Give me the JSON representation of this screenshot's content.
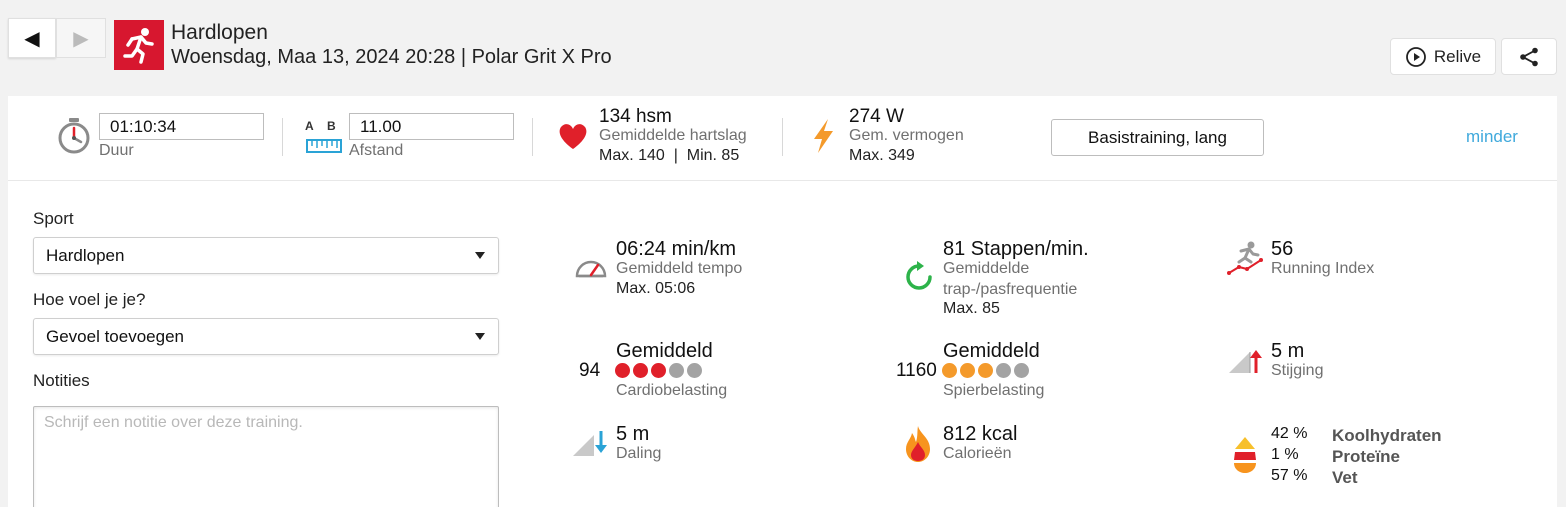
{
  "header": {
    "title": "Hardlopen",
    "subtitle": "Woensdag, Maa 13, 2024 20:28 | Polar Grit X Pro",
    "back_glyph": "◀",
    "forward_glyph": "▶",
    "relive_label": "Relive",
    "icons": {
      "sport": "running-icon",
      "relive": "play-circle-icon",
      "share": "share-icon"
    },
    "accent_color": "#d7172f"
  },
  "summary": {
    "duration": {
      "value": "01:10:34",
      "label": "Duur"
    },
    "distance": {
      "value": "11.00",
      "label": "Afstand",
      "a": "A",
      "b": "B"
    },
    "heart_rate": {
      "value": "134 hsm",
      "label": "Gemiddelde hartslag",
      "max": "Max. 140",
      "sep": "|",
      "min": "Min. 85"
    },
    "power": {
      "value": "274 W",
      "label": "Gem. vermogen",
      "max": "Max. 349"
    },
    "training_type": "Basistraining, lang",
    "less_link": "minder",
    "link_color": "#3fa9dc"
  },
  "form": {
    "sport_label": "Sport",
    "sport_value": "Hardlopen",
    "feeling_label": "Hoe voel je je?",
    "feeling_value": "Gevoel toevoegen",
    "notes_label": "Notities",
    "notes_placeholder": "Schrijf een notitie over deze training."
  },
  "metrics": {
    "pace": {
      "value": "06:24 min/km",
      "label": "Gemiddeld tempo",
      "max": "Max. 05:06"
    },
    "cadence": {
      "value": "81 Stappen/min.",
      "label1": "Gemiddelde",
      "label2": "trap-/pasfrequentie",
      "max": "Max. 85"
    },
    "running_index": {
      "value": "56",
      "label": "Running Index"
    },
    "cardio_load": {
      "number": "94",
      "value": "Gemiddeld",
      "label": "Cardiobelasting",
      "level": 3,
      "of": 5,
      "color": "#e0202a"
    },
    "muscle_load": {
      "number": "1160",
      "value": "Gemiddeld",
      "label": "Spierbelasting",
      "level": 3,
      "of": 5,
      "color": "#f49a2b"
    },
    "ascent": {
      "value": "5 m",
      "label": "Stijging"
    },
    "descent": {
      "value": "5 m",
      "label": "Daling"
    },
    "calories": {
      "value": "812 kcal",
      "label": "Calorieën"
    },
    "macros": [
      {
        "pct": "42 %",
        "name": "Koolhydraten"
      },
      {
        "pct": "1 %",
        "name": "Proteïne"
      },
      {
        "pct": "57 %",
        "name": "Vet"
      }
    ]
  }
}
